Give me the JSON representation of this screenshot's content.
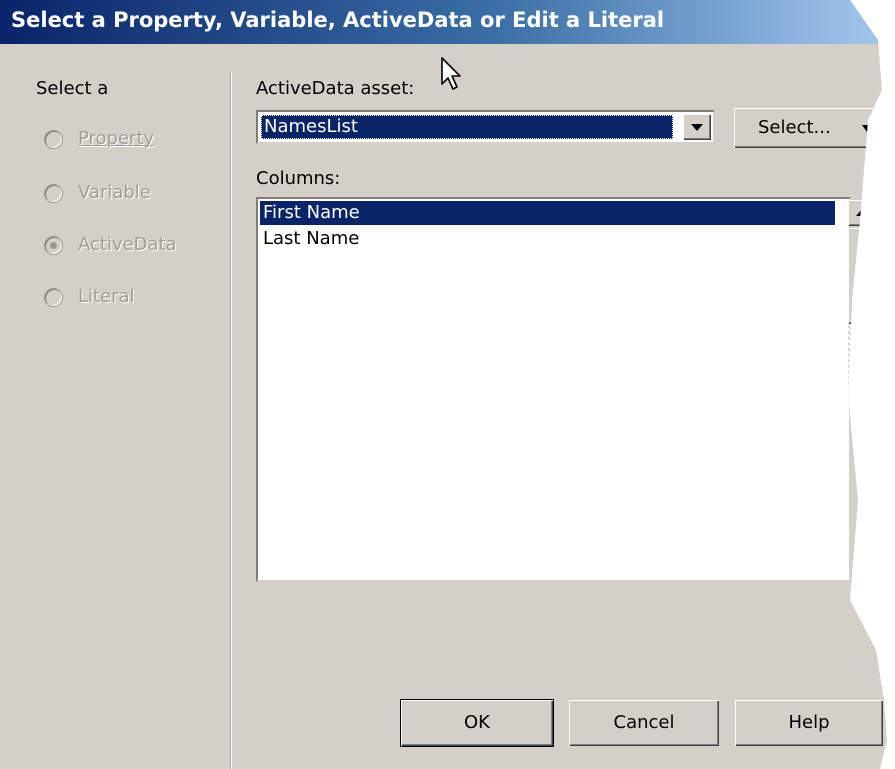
{
  "window": {
    "title": "Select a Property, Variable, ActiveData or Edit a Literal"
  },
  "left_panel": {
    "heading": "Select a",
    "options": [
      {
        "label": "Property",
        "selected": false
      },
      {
        "label": "Variable",
        "selected": false
      },
      {
        "label": "ActiveData",
        "selected": true
      },
      {
        "label": "Literal",
        "selected": false
      }
    ]
  },
  "asset": {
    "label": "ActiveData asset:",
    "value": "NamesList",
    "select_button": "Select..."
  },
  "columns": {
    "label": "Columns:",
    "items": [
      "First Name",
      "Last Name"
    ],
    "selected_index": 0
  },
  "buttons": {
    "ok": "OK",
    "cancel": "Cancel",
    "help": "Help"
  },
  "colors": {
    "dialog_bg": "#d4d0c8",
    "selection": "#0a246a",
    "title_gradient_start": "#0a246a",
    "title_gradient_end": "#a6caf0"
  }
}
